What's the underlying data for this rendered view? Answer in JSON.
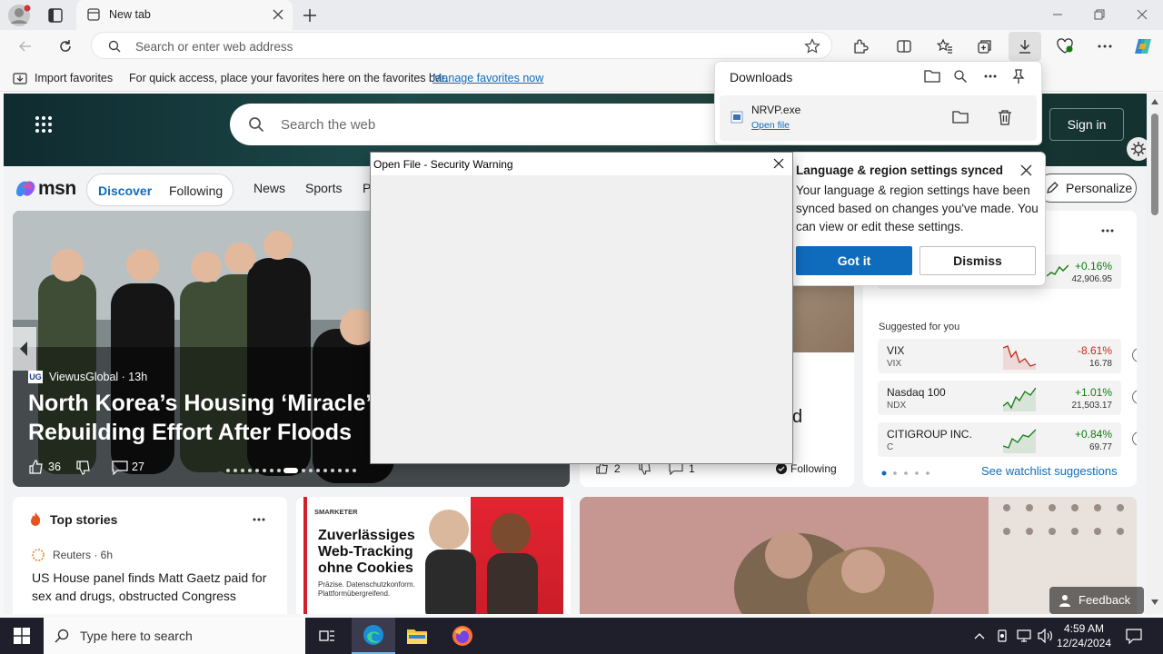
{
  "browser": {
    "tab_title": "New tab",
    "address_placeholder": "Search or enter web address"
  },
  "favorites_bar": {
    "import_label": "Import favorites",
    "hint": "For quick access, place your favorites here on the favorites bar.",
    "manage_link": "Manage favorites now"
  },
  "downloads": {
    "title": "Downloads",
    "file_name": "NRVP.exe",
    "open_link": "Open file"
  },
  "msn": {
    "search_placeholder": "Search the web",
    "sign_in": "Sign in",
    "logo": "msn",
    "tabs": [
      "Discover",
      "Following"
    ],
    "nav": [
      "News",
      "Sports",
      "P"
    ],
    "personalize": "Personalize"
  },
  "hero": {
    "source": "ViewusGlobal · 13h",
    "source_badge": "UG",
    "title": "North Korea’s Housing ‘Miracle’: Ki… Rebuilding Effort After Floods",
    "title_line1": "North Korea’s Housing ‘Miracle’: Ki",
    "title_line2": "Rebuilding Effort After Floods",
    "likes": "36",
    "comments": "27"
  },
  "card2": {
    "likes": "2",
    "comments": "1",
    "following": "Following",
    "title_tail": "d"
  },
  "watchlist": {
    "top_stock": {
      "change": "+0.16%",
      "price": "42,906.95"
    },
    "suggested_label": "Suggested for you",
    "stocks": [
      {
        "name": "VIX",
        "ticker": "VIX",
        "change": "-8.61%",
        "price": "16.78",
        "color": "#c42b1c"
      },
      {
        "name": "Nasdaq 100",
        "ticker": "NDX",
        "change": "+1.01%",
        "price": "21,503.17",
        "color": "#107c10"
      },
      {
        "name": "CITIGROUP INC.",
        "ticker": "C",
        "change": "+0.84%",
        "price": "69.77",
        "color": "#107c10"
      }
    ],
    "see_more": "See watchlist suggestions"
  },
  "top_stories": {
    "title": "Top stories",
    "source": "Reuters · 6h",
    "headline": "US House panel finds Matt Gaetz paid for sex and drugs, obstructed Congress"
  },
  "ad": {
    "brand": "SMARKETER",
    "headline": "Zuverlässiges Web-Tracking ohne Cookies",
    "sub": "Präzise. Datenschutzkonform. Plattformübergreifend."
  },
  "feedback": "Feedback",
  "sync_popup": {
    "title": "Language & region settings synced",
    "body": "Your language & region settings have been synced based on changes you've made. You can view or edit these settings.",
    "got_it": "Got it",
    "dismiss": "Dismiss"
  },
  "security_dialog": {
    "title": "Open File - Security Warning"
  },
  "taskbar": {
    "search_placeholder": "Type here to search",
    "time": "4:59 AM",
    "date": "12/24/2024"
  },
  "colors": {
    "accent": "#0f6cbd",
    "positive": "#107c10",
    "negative": "#c42b1c"
  }
}
